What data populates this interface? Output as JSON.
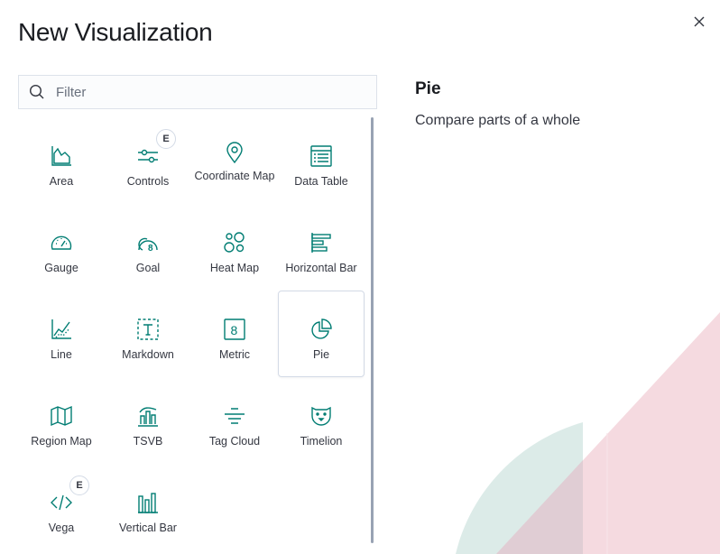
{
  "modal": {
    "title": "New Visualization",
    "close_icon": "close-icon"
  },
  "search": {
    "placeholder": "Filter",
    "value": "",
    "icon": "search-icon"
  },
  "cards": [
    {
      "label": "Area",
      "icon": "area-chart-icon",
      "badge": ""
    },
    {
      "label": "Controls",
      "icon": "controls-icon",
      "badge": "E"
    },
    {
      "label": "Coordinate Map",
      "icon": "map-pin-icon",
      "badge": ""
    },
    {
      "label": "Data Table",
      "icon": "data-table-icon",
      "badge": ""
    },
    {
      "label": "Gauge",
      "icon": "gauge-icon",
      "badge": ""
    },
    {
      "label": "Goal",
      "icon": "goal-icon",
      "badge": ""
    },
    {
      "label": "Heat Map",
      "icon": "heat-map-icon",
      "badge": ""
    },
    {
      "label": "Horizontal Bar",
      "icon": "horizontal-bar-icon",
      "badge": ""
    },
    {
      "label": "Line",
      "icon": "line-chart-icon",
      "badge": ""
    },
    {
      "label": "Markdown",
      "icon": "markdown-icon",
      "badge": ""
    },
    {
      "label": "Metric",
      "icon": "metric-icon",
      "badge": ""
    },
    {
      "label": "Pie",
      "icon": "pie-chart-icon",
      "badge": ""
    },
    {
      "label": "Region Map",
      "icon": "region-map-icon",
      "badge": ""
    },
    {
      "label": "TSVB",
      "icon": "tsvb-icon",
      "badge": ""
    },
    {
      "label": "Tag Cloud",
      "icon": "tag-cloud-icon",
      "badge": ""
    },
    {
      "label": "Timelion",
      "icon": "timelion-icon",
      "badge": ""
    },
    {
      "label": "Vega",
      "icon": "vega-code-icon",
      "badge": "E"
    },
    {
      "label": "Vertical Bar",
      "icon": "vertical-bar-icon",
      "badge": ""
    }
  ],
  "selected": {
    "title": "Pie",
    "description": "Compare parts of a whole"
  },
  "colors": {
    "icon": "#017d73",
    "illustration_pink": "#f4d6dd",
    "illustration_teal": "#dcebe8"
  }
}
